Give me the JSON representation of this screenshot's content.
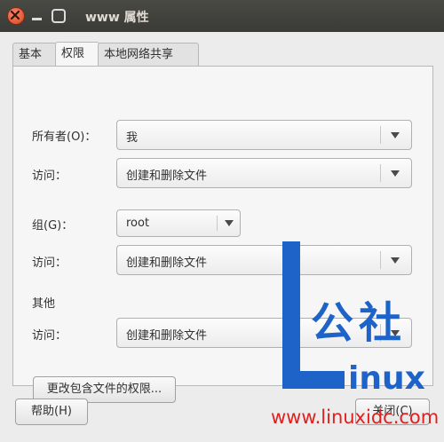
{
  "window": {
    "title": "www 属性"
  },
  "tabs": [
    {
      "label": "基本"
    },
    {
      "label": "权限"
    },
    {
      "label": "本地网络共享"
    }
  ],
  "owner": {
    "label": "所有者(O)：",
    "value": "我"
  },
  "owner_access": {
    "label": "访问：",
    "value": "创建和删除文件"
  },
  "group": {
    "label": "组(G)：",
    "value": "root"
  },
  "group_access": {
    "label": "访问：",
    "value": "创建和删除文件"
  },
  "others": {
    "heading": "其他",
    "access_label": "访问：",
    "access_value": "创建和删除文件"
  },
  "buttons": {
    "change_enclosed": "更改包含文件的权限...",
    "help": "帮助(H)",
    "close": "关闭(C)"
  },
  "watermark": {
    "big": "公社",
    "inux": "inux",
    "url": "www.linuxidc.com"
  },
  "colors": {
    "titlebar": "#3c3b37",
    "close_button": "#e0582c",
    "watermark_blue": "#1e64c8",
    "watermark_red": "#e02020"
  }
}
